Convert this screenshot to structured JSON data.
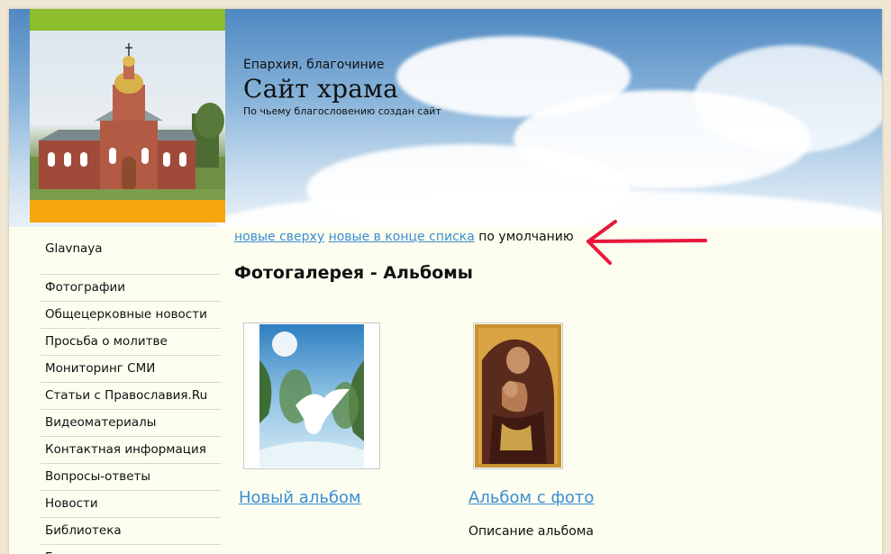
{
  "header": {
    "eparchy": "Епархия, благочиние",
    "title": "Сайт храма",
    "blessing": "По чьему благословению создан сайт"
  },
  "sidebar": {
    "top_item": "Glavnaya",
    "items": [
      "Фотографии",
      "Общецерковные новости",
      "Просьба о молитве",
      "Мониторинг СМИ",
      "Статьи с Православия.Ru",
      "Видеоматериалы",
      "Контактная информация",
      "Вопросы-ответы",
      "Новости",
      "Библиотека",
      "Гостевая книга"
    ]
  },
  "sort": {
    "newest_first": "новые сверху",
    "newest_last": "новые в конце списка",
    "default": "по умолчанию"
  },
  "gallery": {
    "title": "Фотогалерея - Альбомы",
    "albums": [
      {
        "name": "Новый альбом",
        "description": ""
      },
      {
        "name": "Альбом с фото",
        "description": "Описание альбома"
      }
    ]
  },
  "colors": {
    "link": "#3b8ed3",
    "green_bar": "#8cbd2b",
    "orange_bar": "#f5a60c",
    "arrow": "#e8173c"
  }
}
